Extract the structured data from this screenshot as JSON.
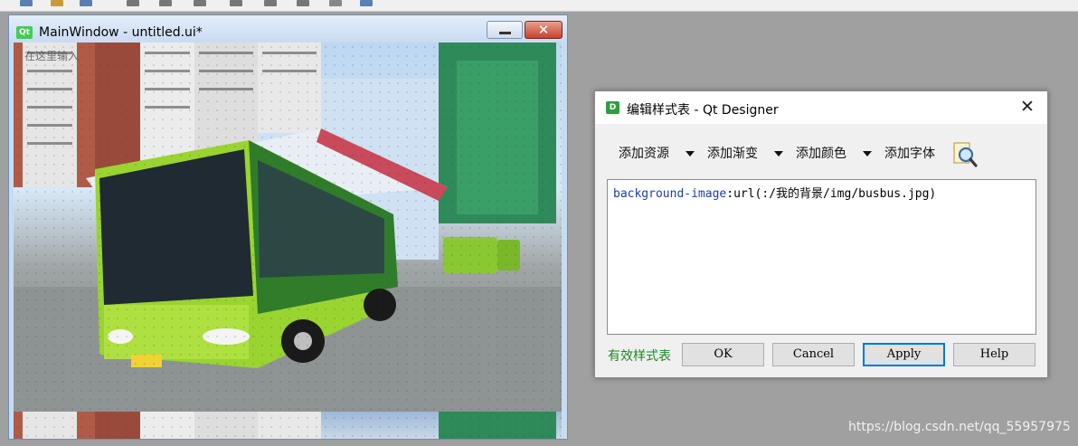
{
  "main_window": {
    "logo_text": "Qt",
    "title": "MainWindow - untitled.ui*",
    "menu_ghost": "在这里输入"
  },
  "dialog": {
    "logo_text": "D",
    "title": "编辑样式表 - Qt Designer",
    "close_glyph": "✕",
    "toolbar": {
      "add_resource": "添加资源",
      "add_gradient": "添加渐变",
      "add_color": "添加颜色",
      "add_font": "添加字体"
    },
    "editor": {
      "property": "background-image",
      "colon": ":",
      "value": "url(:/我的背景/img/busbus.jpg)"
    },
    "status": "有效样式表",
    "buttons": {
      "ok": "OK",
      "cancel": "Cancel",
      "apply": "Apply",
      "help": "Help"
    }
  },
  "watermark": "https://blog.csdn.net/qq_55957975",
  "icons": [
    "qt-logo-icon",
    "designer-logo-icon",
    "minimize-icon",
    "close-icon",
    "dropdown-arrow-icon",
    "find-icon"
  ]
}
